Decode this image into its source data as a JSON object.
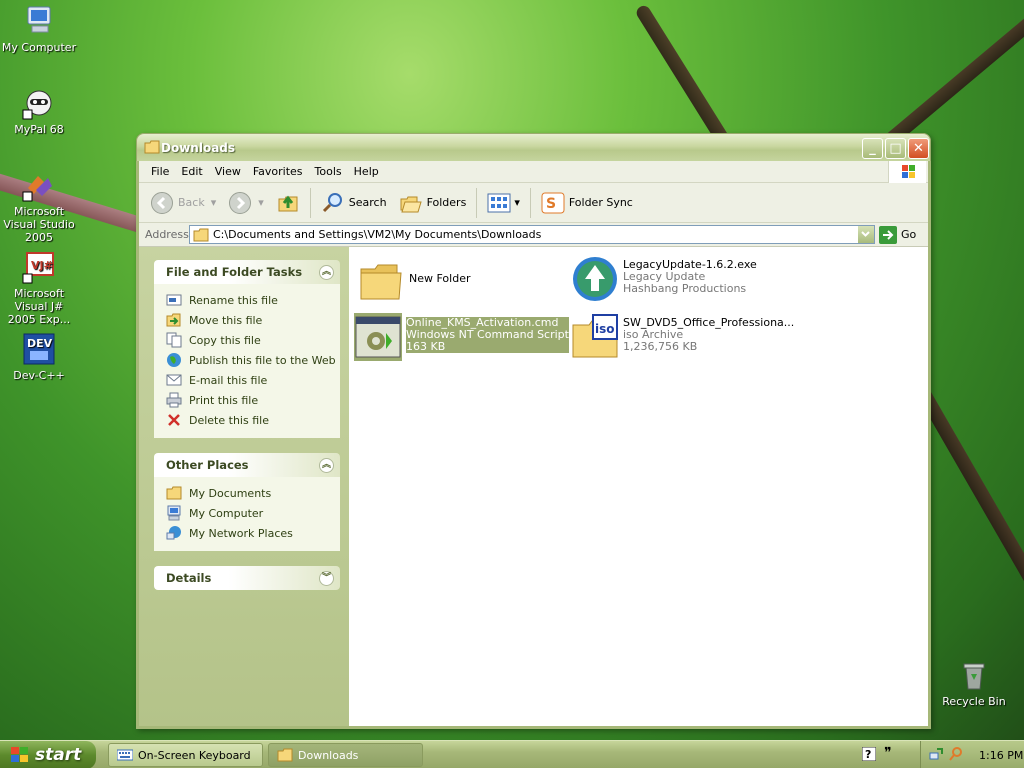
{
  "desktop": {
    "icons": [
      {
        "label": "My Computer"
      },
      {
        "label": "MyPal 68"
      },
      {
        "label": "Microsoft Visual Studio 2005"
      },
      {
        "label": "Microsoft Visual J# 2005 Exp..."
      },
      {
        "label": "Dev-C++"
      },
      {
        "label": "Recycle Bin"
      }
    ]
  },
  "window": {
    "title": "Downloads",
    "menu": [
      "File",
      "Edit",
      "View",
      "Favorites",
      "Tools",
      "Help"
    ],
    "toolbar": {
      "back": "Back",
      "search": "Search",
      "folders": "Folders",
      "folder_sync": "Folder Sync"
    },
    "address": {
      "label": "Address",
      "value": "C:\\Documents and Settings\\VM2\\My Documents\\Downloads",
      "go": "Go"
    }
  },
  "taskpane": {
    "file_tasks": {
      "title": "File and Folder Tasks",
      "items": [
        {
          "label": "Rename this file",
          "icon": "rename-icon"
        },
        {
          "label": "Move this file",
          "icon": "move-icon"
        },
        {
          "label": "Copy this file",
          "icon": "copy-icon"
        },
        {
          "label": "Publish this file to the Web",
          "icon": "globe-icon"
        },
        {
          "label": "E-mail this file",
          "icon": "email-icon"
        },
        {
          "label": "Print this file",
          "icon": "printer-icon"
        },
        {
          "label": "Delete this file",
          "icon": "delete-icon"
        }
      ]
    },
    "other_places": {
      "title": "Other Places",
      "items": [
        {
          "label": "My Documents",
          "icon": "folder-icon"
        },
        {
          "label": "My Computer",
          "icon": "computer-icon"
        },
        {
          "label": "My Network Places",
          "icon": "network-icon"
        }
      ]
    },
    "details": {
      "title": "Details"
    }
  },
  "files": [
    {
      "name": "New Folder",
      "type": "",
      "size": ""
    },
    {
      "name": "LegacyUpdate-1.6.2.exe",
      "type": "Legacy Update",
      "size": "Hashbang Productions"
    },
    {
      "name": "Online_KMS_Activation.cmd",
      "type": "Windows NT Command Script",
      "size": "163 KB",
      "selected": true
    },
    {
      "name": "SW_DVD5_Office_Professiona...",
      "type": "iso Archive",
      "size": "1,236,756 KB"
    }
  ],
  "taskbar": {
    "start": "start",
    "buttons": [
      "On-Screen Keyboard",
      "Downloads"
    ],
    "clock": "1:16 PM"
  },
  "colors": {
    "selection": "#9aaa6f",
    "taskpane": "#c7d3a1",
    "titlebar": "#c9d7a0"
  }
}
